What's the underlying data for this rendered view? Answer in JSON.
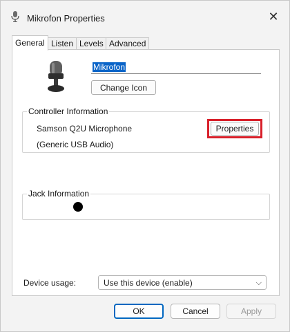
{
  "window": {
    "title": "Mikrofon Properties",
    "close_icon": "close-icon"
  },
  "tabs": [
    {
      "label": "General",
      "active": true
    },
    {
      "label": "Listen",
      "active": false
    },
    {
      "label": "Levels",
      "active": false
    },
    {
      "label": "Advanced",
      "active": false
    }
  ],
  "general": {
    "device_icon": "microphone-icon",
    "device_name": "Mikrofon",
    "change_icon_label": "Change Icon",
    "controller": {
      "heading": "Controller Information",
      "name": "Samson Q2U Microphone",
      "driver": "(Generic USB Audio)",
      "properties_label": "Properties",
      "highlight_color": "#d8202a"
    },
    "jack": {
      "heading": "Jack Information",
      "dot_color": "#000000"
    },
    "device_usage": {
      "label": "Device usage:",
      "selected": "Use this device (enable)"
    }
  },
  "footer": {
    "ok": "OK",
    "cancel": "Cancel",
    "apply": "Apply",
    "apply_enabled": false
  },
  "colors": {
    "accent": "#0067c0",
    "selection": "#0a64c8"
  }
}
